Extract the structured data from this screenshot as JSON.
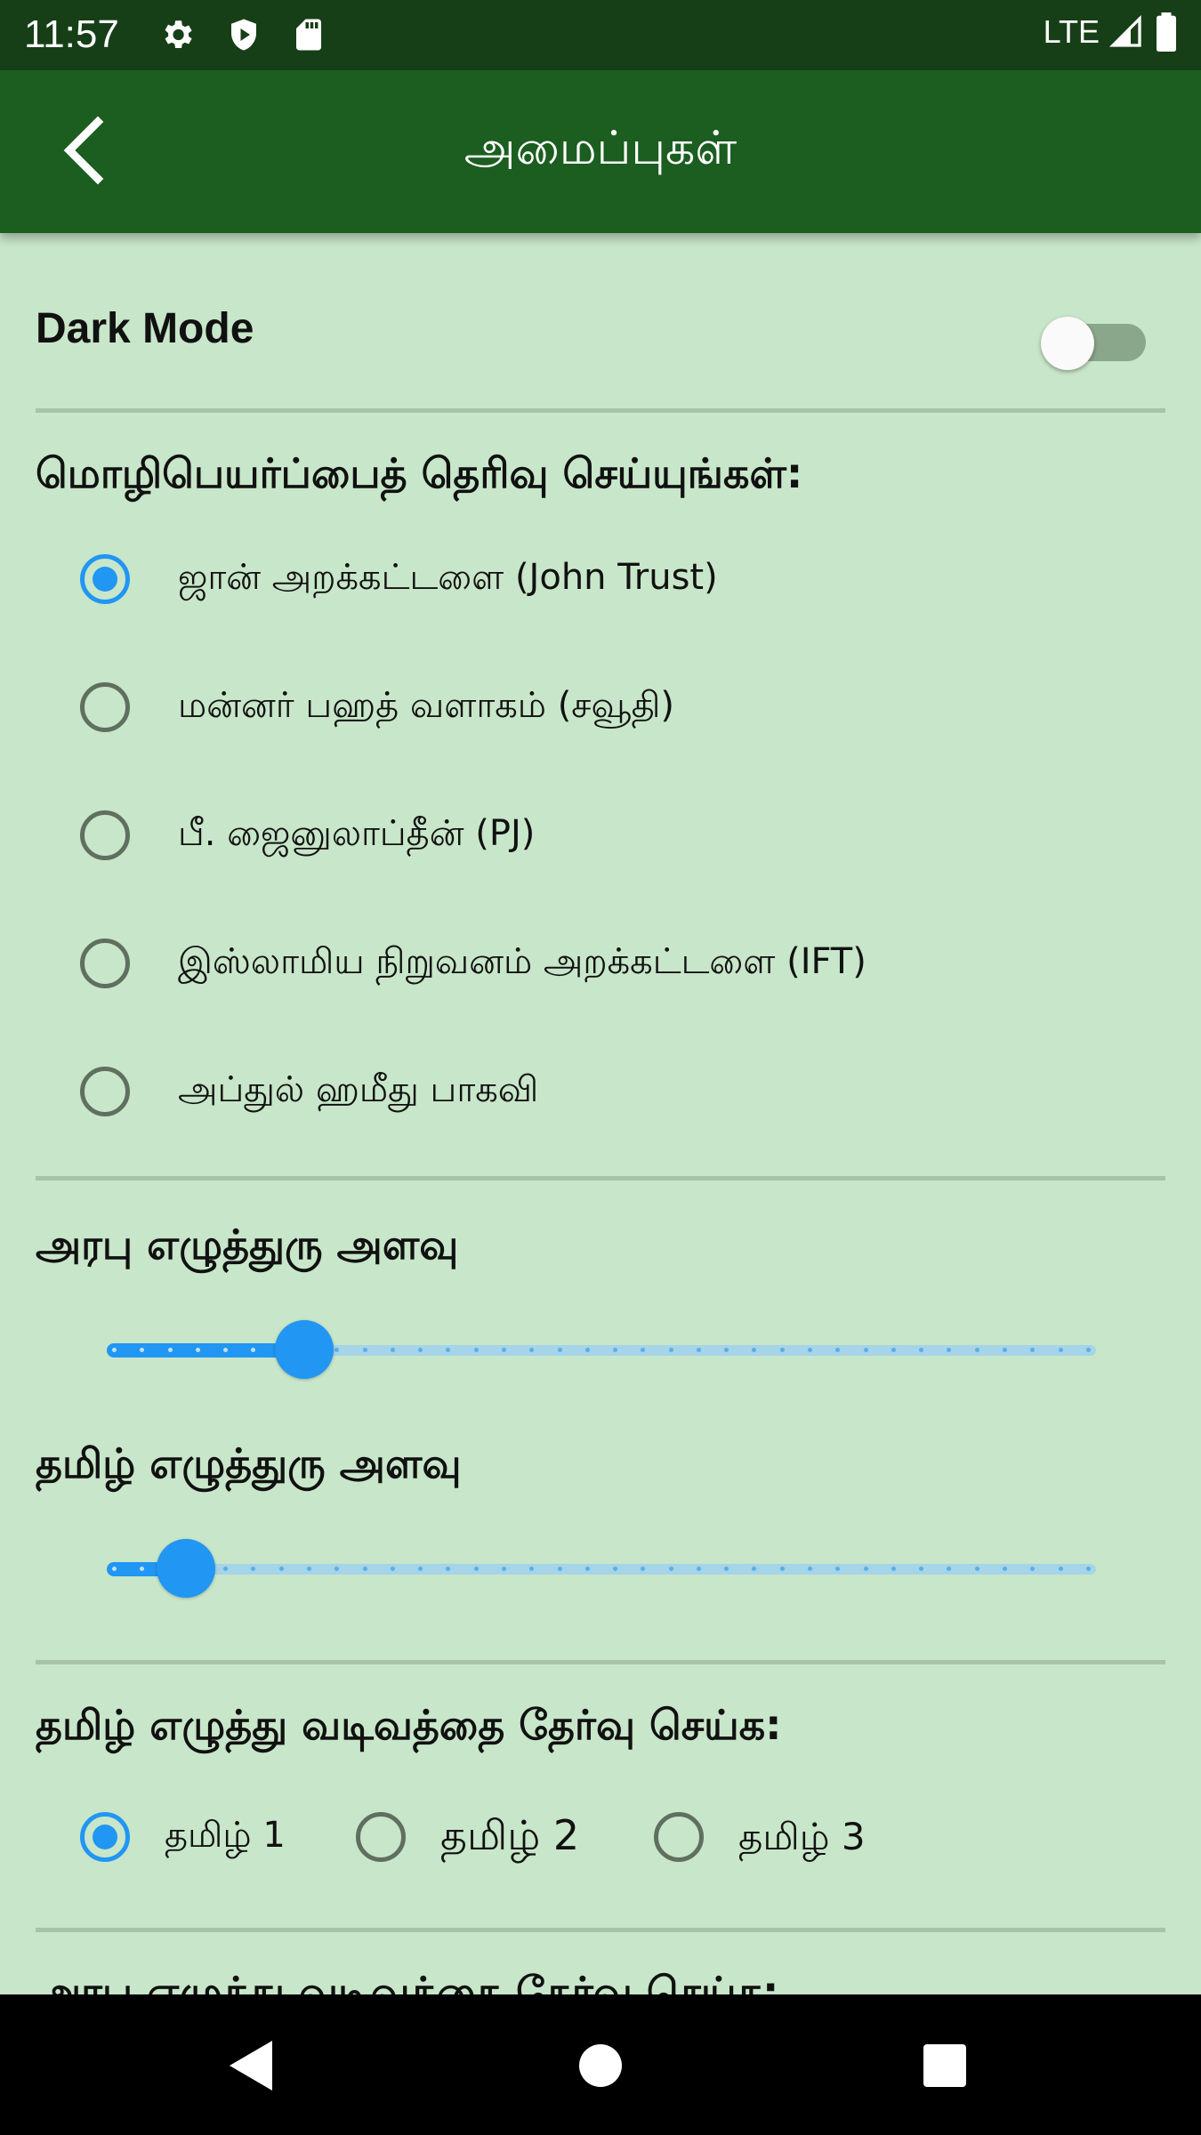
{
  "status_bar": {
    "time": "11:57",
    "network": "LTE",
    "icons": [
      "gear-icon",
      "shield-icon",
      "sd-card-icon",
      "signal-icon",
      "battery-icon"
    ]
  },
  "app_bar": {
    "title": "அமைப்புகள்",
    "back_icon": "chevron-left-icon"
  },
  "dark_mode": {
    "label": "Dark Mode",
    "enabled": false
  },
  "translation": {
    "title": "மொழிபெயர்ப்பைத் தெரிவு செய்யுங்கள்:",
    "options": [
      {
        "label": "ஜான் அறக்கட்டளை (John Trust)",
        "selected": true
      },
      {
        "label": "மன்னர் பஹத் வளாகம் (சவூதி)",
        "selected": false
      },
      {
        "label": "பீ. ஜைனுலாப்தீன் (PJ)",
        "selected": false
      },
      {
        "label": "இஸ்லாமிய நிறுவனம் அறக்கட்டளை (IFT)",
        "selected": false
      },
      {
        "label": "அப்துல் ஹமீது பாகவி",
        "selected": false
      }
    ]
  },
  "arabic_font_size": {
    "label": "அரபு எழுத்துரு அளவு",
    "value_fraction": 0.2
  },
  "tamil_font_size": {
    "label": "தமிழ் எழுத்துரு அளவு",
    "value_fraction": 0.08
  },
  "tamil_font_style": {
    "title": "தமிழ் எழுத்து வடிவத்தை தேர்வு செய்க:",
    "options": [
      {
        "label": "தமிழ் 1",
        "selected": true
      },
      {
        "label": "தமிழ் 2",
        "selected": false
      },
      {
        "label": "தமிழ் 3",
        "selected": false
      }
    ]
  },
  "arabic_font_style": {
    "title": "அரபு எழுத்து வடிவத்தை தேர்வு செய்க:"
  },
  "colors": {
    "status_bar": "#173f17",
    "app_bar": "#1b5e20",
    "background": "#c8e6c9",
    "accent": "#2196f3"
  },
  "nav_bar": {
    "icons": [
      "back-triangle-icon",
      "home-circle-icon",
      "recents-square-icon"
    ]
  }
}
